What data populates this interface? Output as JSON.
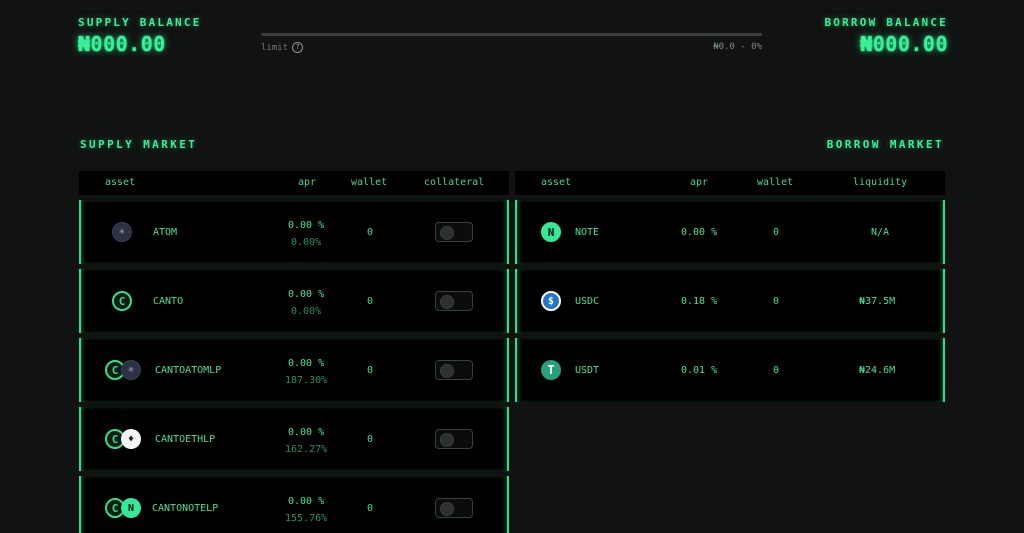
{
  "header": {
    "supply_label": "SUPPLY BALANCE",
    "supply_value": "₦000.00",
    "borrow_label": "BORROW BALANCE",
    "borrow_value": "₦000.00",
    "limit_label": "limit",
    "limit_value": "₦0.0 - 0%",
    "limit_progress_percent": 0
  },
  "supply_market": {
    "title": "SUPPLY MARKET",
    "columns": [
      "asset",
      "apr",
      "wallet",
      "collateral"
    ],
    "rows": [
      {
        "symbol": "ATOM",
        "apr": "0.00 %",
        "apr_reward": "0.00%",
        "wallet": "0",
        "icons": [
          "atom-icon"
        ],
        "collateral": false
      },
      {
        "symbol": "CANTO",
        "apr": "0.00 %",
        "apr_reward": "0.00%",
        "wallet": "0",
        "icons": [
          "canto-icon"
        ],
        "collateral": false
      },
      {
        "symbol": "CANTOATOMLP",
        "apr": "0.00 %",
        "apr_reward": "187.30%",
        "wallet": "0",
        "icons": [
          "canto-icon",
          "atom-icon"
        ],
        "collateral": false
      },
      {
        "symbol": "CANTOETHLP",
        "apr": "0.00 %",
        "apr_reward": "162.27%",
        "wallet": "0",
        "icons": [
          "canto-icon",
          "eth-icon"
        ],
        "collateral": false
      },
      {
        "symbol": "CANTONOTELP",
        "apr": "0.00 %",
        "apr_reward": "155.76%",
        "wallet": "0",
        "icons": [
          "canto-icon",
          "note-icon"
        ],
        "collateral": false
      }
    ]
  },
  "borrow_market": {
    "title": "BORROW MARKET",
    "columns": [
      "asset",
      "apr",
      "wallet",
      "liquidity"
    ],
    "rows": [
      {
        "symbol": "NOTE",
        "apr": "0.00 %",
        "wallet": "0",
        "liquidity": "N/A",
        "icon": "note-icon"
      },
      {
        "symbol": "USDC",
        "apr": "0.18 %",
        "wallet": "0",
        "liquidity": "₦37.5M",
        "icon": "usdc-icon"
      },
      {
        "symbol": "USDT",
        "apr": "0.01 %",
        "wallet": "0",
        "liquidity": "₦24.6M",
        "icon": "usdt-icon"
      }
    ]
  },
  "colors": {
    "accent": "#2fe08a",
    "background": "#111212",
    "panel": "#000000"
  }
}
